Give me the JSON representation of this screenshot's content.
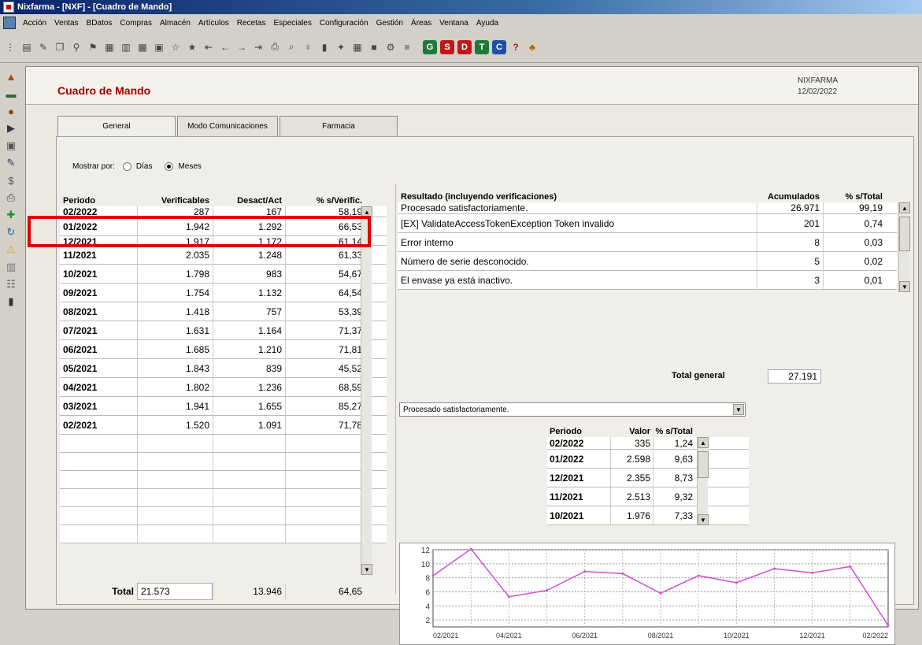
{
  "window": {
    "title": "Nixfarma - [NXF] - [Cuadro de Mando]"
  },
  "menu": [
    "Acción",
    "Ventas",
    "BDatos",
    "Compras",
    "Almacén",
    "Artículos",
    "Recetas",
    "Especiales",
    "Configuración",
    "Gestión",
    "Áreas",
    "Ventana",
    "Ayuda"
  ],
  "toolbar": {
    "letter_buttons": [
      {
        "label": "G",
        "color": "#1f7a3a"
      },
      {
        "label": "S",
        "color": "#c01818"
      },
      {
        "label": "D",
        "color": "#c01818"
      },
      {
        "label": "T",
        "color": "#1f7a3a"
      },
      {
        "label": "C",
        "color": "#1f4fa8"
      }
    ],
    "help_label": "?"
  },
  "header": {
    "title": "Cuadro de Mando",
    "app": "NIXFARMA",
    "date": "12/02/2022"
  },
  "tabs": [
    "General",
    "Modo Comunicaciones",
    "Farmacia"
  ],
  "show_by": {
    "label": "Mostrar por:",
    "options": [
      "Días",
      "Meses"
    ],
    "selected": "Meses"
  },
  "left_table": {
    "headers": [
      "Periodo",
      "Verificables",
      "Desact/Act",
      "% s/Verific."
    ],
    "rows": [
      {
        "periodo": "02/2022",
        "ver": "287",
        "des": "167",
        "pct": "58,19"
      },
      {
        "periodo": "01/2022",
        "ver": "1.942",
        "des": "1.292",
        "pct": "66,53"
      },
      {
        "periodo": "12/2021",
        "ver": "1.917",
        "des": "1.172",
        "pct": "61,14"
      },
      {
        "periodo": "11/2021",
        "ver": "2.035",
        "des": "1.248",
        "pct": "61,33"
      },
      {
        "periodo": "10/2021",
        "ver": "1.798",
        "des": "983",
        "pct": "54,67"
      },
      {
        "periodo": "09/2021",
        "ver": "1.754",
        "des": "1.132",
        "pct": "64,54"
      },
      {
        "periodo": "08/2021",
        "ver": "1.418",
        "des": "757",
        "pct": "53,39"
      },
      {
        "periodo": "07/2021",
        "ver": "1.631",
        "des": "1.164",
        "pct": "71,37"
      },
      {
        "periodo": "06/2021",
        "ver": "1.685",
        "des": "1.210",
        "pct": "71,81"
      },
      {
        "periodo": "05/2021",
        "ver": "1.843",
        "des": "839",
        "pct": "45,52"
      },
      {
        "periodo": "04/2021",
        "ver": "1.802",
        "des": "1.236",
        "pct": "68,59"
      },
      {
        "periodo": "03/2021",
        "ver": "1.941",
        "des": "1.655",
        "pct": "85,27"
      },
      {
        "periodo": "02/2021",
        "ver": "1.520",
        "des": "1.091",
        "pct": "71,78"
      }
    ],
    "total": {
      "label": "Total",
      "ver": "21.573",
      "des": "13.946",
      "pct": "64,65"
    }
  },
  "results": {
    "headers": [
      "Resultado (incluyendo verificaciones)",
      "Acumulados",
      "% s/Total"
    ],
    "rows": [
      {
        "res": "Procesado satisfactoriamente.",
        "acc": "26.971",
        "pct": "99,19"
      },
      {
        "res": "[EX] ValidateAccessTokenException Token invalido",
        "acc": "201",
        "pct": "0,74"
      },
      {
        "res": "Error interno",
        "acc": "8",
        "pct": "0,03"
      },
      {
        "res": "Número de serie desconocido.",
        "acc": "5",
        "pct": "0,02"
      },
      {
        "res": "El envase ya está inactivo.",
        "acc": "3",
        "pct": "0,01"
      }
    ],
    "total_label": "Total general",
    "total_value": "27.191"
  },
  "filter_select": {
    "value": "Procesado satisfactoriamente."
  },
  "sub_table": {
    "headers": [
      "Periodo",
      "Valor",
      "% s/Total"
    ],
    "rows": [
      {
        "periodo": "02/2022",
        "val": "335",
        "pct": "1,24"
      },
      {
        "periodo": "01/2022",
        "val": "2.598",
        "pct": "9,63"
      },
      {
        "periodo": "12/2021",
        "val": "2.355",
        "pct": "8,73"
      },
      {
        "periodo": "11/2021",
        "val": "2.513",
        "pct": "9,32"
      },
      {
        "periodo": "10/2021",
        "val": "1.976",
        "pct": "7,33"
      }
    ]
  },
  "chart_data": {
    "type": "line",
    "x": [
      "02/2021",
      "03/2021",
      "04/2021",
      "05/2021",
      "06/2021",
      "07/2021",
      "08/2021",
      "09/2021",
      "10/2021",
      "11/2021",
      "12/2021",
      "01/2022",
      "02/2022"
    ],
    "x_tick_labels": [
      "02/2021",
      "04/2021",
      "06/2021",
      "08/2021",
      "10/2021",
      "12/2021",
      "02/2022"
    ],
    "y": [
      8.3,
      12.1,
      5.3,
      6.2,
      8.9,
      8.6,
      5.8,
      8.3,
      7.3,
      9.3,
      8.7,
      9.6,
      1.2
    ],
    "ylim": [
      1,
      12
    ],
    "y_ticks": [
      2,
      4,
      6,
      8,
      10,
      12
    ],
    "grid": true,
    "line_color": "#d24fd2"
  }
}
